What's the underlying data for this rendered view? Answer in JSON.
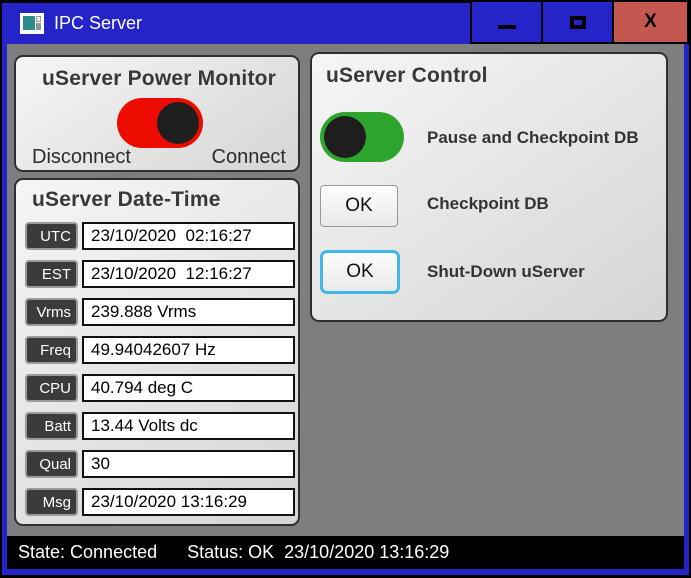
{
  "window": {
    "title": "IPC Server",
    "close_glyph": "X"
  },
  "power_monitor": {
    "title": "uServer Power Monitor",
    "toggle_state": "on",
    "left_label": "Disconnect",
    "right_label": "Connect"
  },
  "datetime": {
    "title": "uServer Date-Time",
    "rows": [
      {
        "label": "UTC",
        "value": "23/10/2020  02:16:27"
      },
      {
        "label": "EST",
        "value": "23/10/2020  12:16:27"
      },
      {
        "label": "Vrms",
        "value": "239.888 Vrms"
      },
      {
        "label": "Freq",
        "value": "49.94042607 Hz"
      },
      {
        "label": "CPU",
        "value": "40.794 deg C"
      },
      {
        "label": "Batt",
        "value": "13.44 Volts dc"
      },
      {
        "label": "Qual",
        "value": "30"
      },
      {
        "label": "Msg",
        "value": "23/10/2020 13:16:29"
      }
    ]
  },
  "control": {
    "title": "uServer Control",
    "items": [
      {
        "type": "toggle",
        "state": "off",
        "label": "Pause and Checkpoint DB"
      },
      {
        "type": "button",
        "button_label": "OK",
        "label": "Checkpoint DB"
      },
      {
        "type": "button",
        "button_label": "OK",
        "label": "Shut-Down uServer",
        "focused": true
      }
    ]
  },
  "status_bar": {
    "state": "State: Connected",
    "status": "Status: OK  23/10/2020 13:16:29"
  },
  "colors": {
    "titlebar_blue": "#2424C8",
    "close_red": "#C5584E",
    "client_gray": "#7E7E7E",
    "toggle_red": "#EE0C00",
    "toggle_green": "#2DA52D",
    "focus_cyan": "#41B7E8",
    "status_black": "#000000"
  }
}
